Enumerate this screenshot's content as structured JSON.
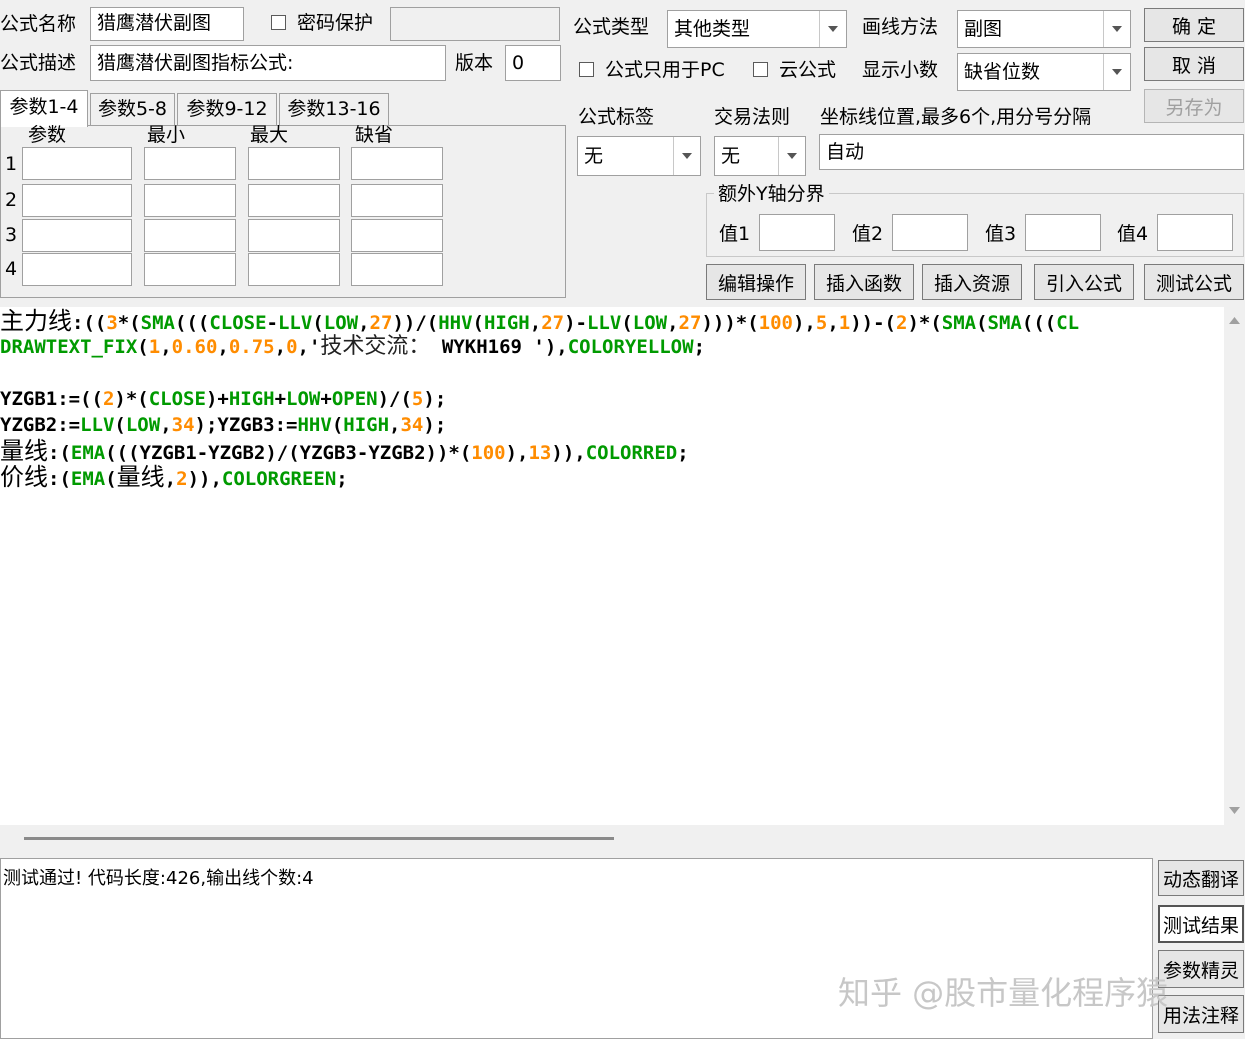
{
  "top": {
    "name_label": "公式名称",
    "name_value": "猎鹰潜伏副图",
    "password_label": "密码保护",
    "desc_label": "公式描述",
    "desc_value": "猎鹰潜伏副图指标公式:",
    "version_label": "版本",
    "version_value": "0",
    "type_label": "公式类型",
    "type_value": "其他类型",
    "draw_label": "画线方法",
    "draw_value": "副图",
    "pc_only_label": "公式只用于PC",
    "cloud_label": "云公式",
    "decimal_label": "显示小数",
    "decimal_value": "缺省位数",
    "ok_label": "确  定",
    "cancel_label": "取  消",
    "saveas_label": "另存为"
  },
  "params": {
    "tabs": [
      "参数1-4",
      "参数5-8",
      "参数9-12",
      "参数13-16"
    ],
    "columns": [
      "参数",
      "最小",
      "最大",
      "缺省"
    ],
    "rows": [
      "1",
      "2",
      "3",
      "4"
    ]
  },
  "right": {
    "tag_label": "公式标签",
    "tag_value": "无",
    "rule_label": "交易法则",
    "rule_value": "无",
    "axis_label": "坐标线位置,最多6个,用分号分隔",
    "axis_value": "自动",
    "extra_y_label": "额外Y轴分界",
    "val_labels": [
      "值1",
      "值2",
      "值3",
      "值4"
    ]
  },
  "actions": [
    "编辑操作",
    "插入函数",
    "插入资源",
    "引入公式",
    "测试公式"
  ],
  "code_lines": [
    [
      [
        "zh",
        "主力线"
      ],
      [
        "k",
        ":(("
      ],
      [
        "n",
        "3"
      ],
      [
        "k",
        "*("
      ],
      [
        "f",
        "SMA"
      ],
      [
        "k",
        "((("
      ],
      [
        "f",
        "CLOSE"
      ],
      [
        "k",
        "-"
      ],
      [
        "f",
        "LLV"
      ],
      [
        "k",
        "("
      ],
      [
        "f",
        "LOW"
      ],
      [
        "k",
        ","
      ],
      [
        "n",
        "27"
      ],
      [
        "k",
        "))/("
      ],
      [
        "f",
        "HHV"
      ],
      [
        "k",
        "("
      ],
      [
        "f",
        "HIGH"
      ],
      [
        "k",
        ","
      ],
      [
        "n",
        "27"
      ],
      [
        "k",
        ")-"
      ],
      [
        "f",
        "LLV"
      ],
      [
        "k",
        "("
      ],
      [
        "f",
        "LOW"
      ],
      [
        "k",
        ","
      ],
      [
        "n",
        "27"
      ],
      [
        "k",
        ")))*("
      ],
      [
        "n",
        "100"
      ],
      [
        "k",
        "),"
      ],
      [
        "n",
        "5"
      ],
      [
        "k",
        ","
      ],
      [
        "n",
        "1"
      ],
      [
        "k",
        "))-("
      ],
      [
        "n",
        "2"
      ],
      [
        "k",
        ")*("
      ],
      [
        "f",
        "SMA"
      ],
      [
        "k",
        "("
      ],
      [
        "f",
        "SMA"
      ],
      [
        "k",
        "((("
      ],
      [
        "f",
        "CL"
      ]
    ],
    [
      [
        "f",
        "DRAWTEXT_FIX"
      ],
      [
        "k",
        "("
      ],
      [
        "n",
        "1"
      ],
      [
        "k",
        ","
      ],
      [
        "n",
        "0.60"
      ],
      [
        "k",
        ","
      ],
      [
        "n",
        "0.75"
      ],
      [
        "k",
        ","
      ],
      [
        "n",
        "0"
      ],
      [
        "k",
        ",'"
      ],
      [
        "t",
        "技术交流："
      ],
      [
        "k",
        " WYKH169 '),"
      ],
      [
        "f",
        "COLORYELLOW"
      ],
      [
        "k",
        ";"
      ]
    ],
    [],
    [
      [
        "k",
        "YZGB1:=(("
      ],
      [
        "n",
        "2"
      ],
      [
        "k",
        ")*("
      ],
      [
        "f",
        "CLOSE"
      ],
      [
        "k",
        ")+"
      ],
      [
        "f",
        "HIGH"
      ],
      [
        "k",
        "+"
      ],
      [
        "f",
        "LOW"
      ],
      [
        "k",
        "+"
      ],
      [
        "f",
        "OPEN"
      ],
      [
        "k",
        ")/("
      ],
      [
        "n",
        "5"
      ],
      [
        "k",
        ");"
      ]
    ],
    [
      [
        "k",
        "YZGB2:="
      ],
      [
        "f",
        "LLV"
      ],
      [
        "k",
        "("
      ],
      [
        "f",
        "LOW"
      ],
      [
        "k",
        ","
      ],
      [
        "n",
        "34"
      ],
      [
        "k",
        ");YZGB3:="
      ],
      [
        "f",
        "HHV"
      ],
      [
        "k",
        "("
      ],
      [
        "f",
        "HIGH"
      ],
      [
        "k",
        ","
      ],
      [
        "n",
        "34"
      ],
      [
        "k",
        ");"
      ]
    ],
    [
      [
        "zh",
        "量线"
      ],
      [
        "k",
        ":("
      ],
      [
        "f",
        "EMA"
      ],
      [
        "k",
        "(((YZGB1-YZGB2)/(YZGB3-YZGB2))*("
      ],
      [
        "n",
        "100"
      ],
      [
        "k",
        "),"
      ],
      [
        "n",
        "13"
      ],
      [
        "k",
        ")),"
      ],
      [
        "f",
        "COLORRED"
      ],
      [
        "k",
        ";"
      ]
    ],
    [
      [
        "zh",
        "价线"
      ],
      [
        "k",
        ":("
      ],
      [
        "f",
        "EMA"
      ],
      [
        "k",
        "("
      ],
      [
        "zh",
        "量线"
      ],
      [
        "k",
        ","
      ],
      [
        "n",
        "2"
      ],
      [
        "k",
        ")),"
      ],
      [
        "f",
        "COLORGREEN"
      ],
      [
        "k",
        ";"
      ]
    ]
  ],
  "status_text": "测试通过! 代码长度:426,输出线个数:4",
  "side_buttons": [
    "动态翻译",
    "测试结果",
    "参数精灵",
    "用法注释"
  ],
  "watermark": "知乎 @股市量化程序猿"
}
